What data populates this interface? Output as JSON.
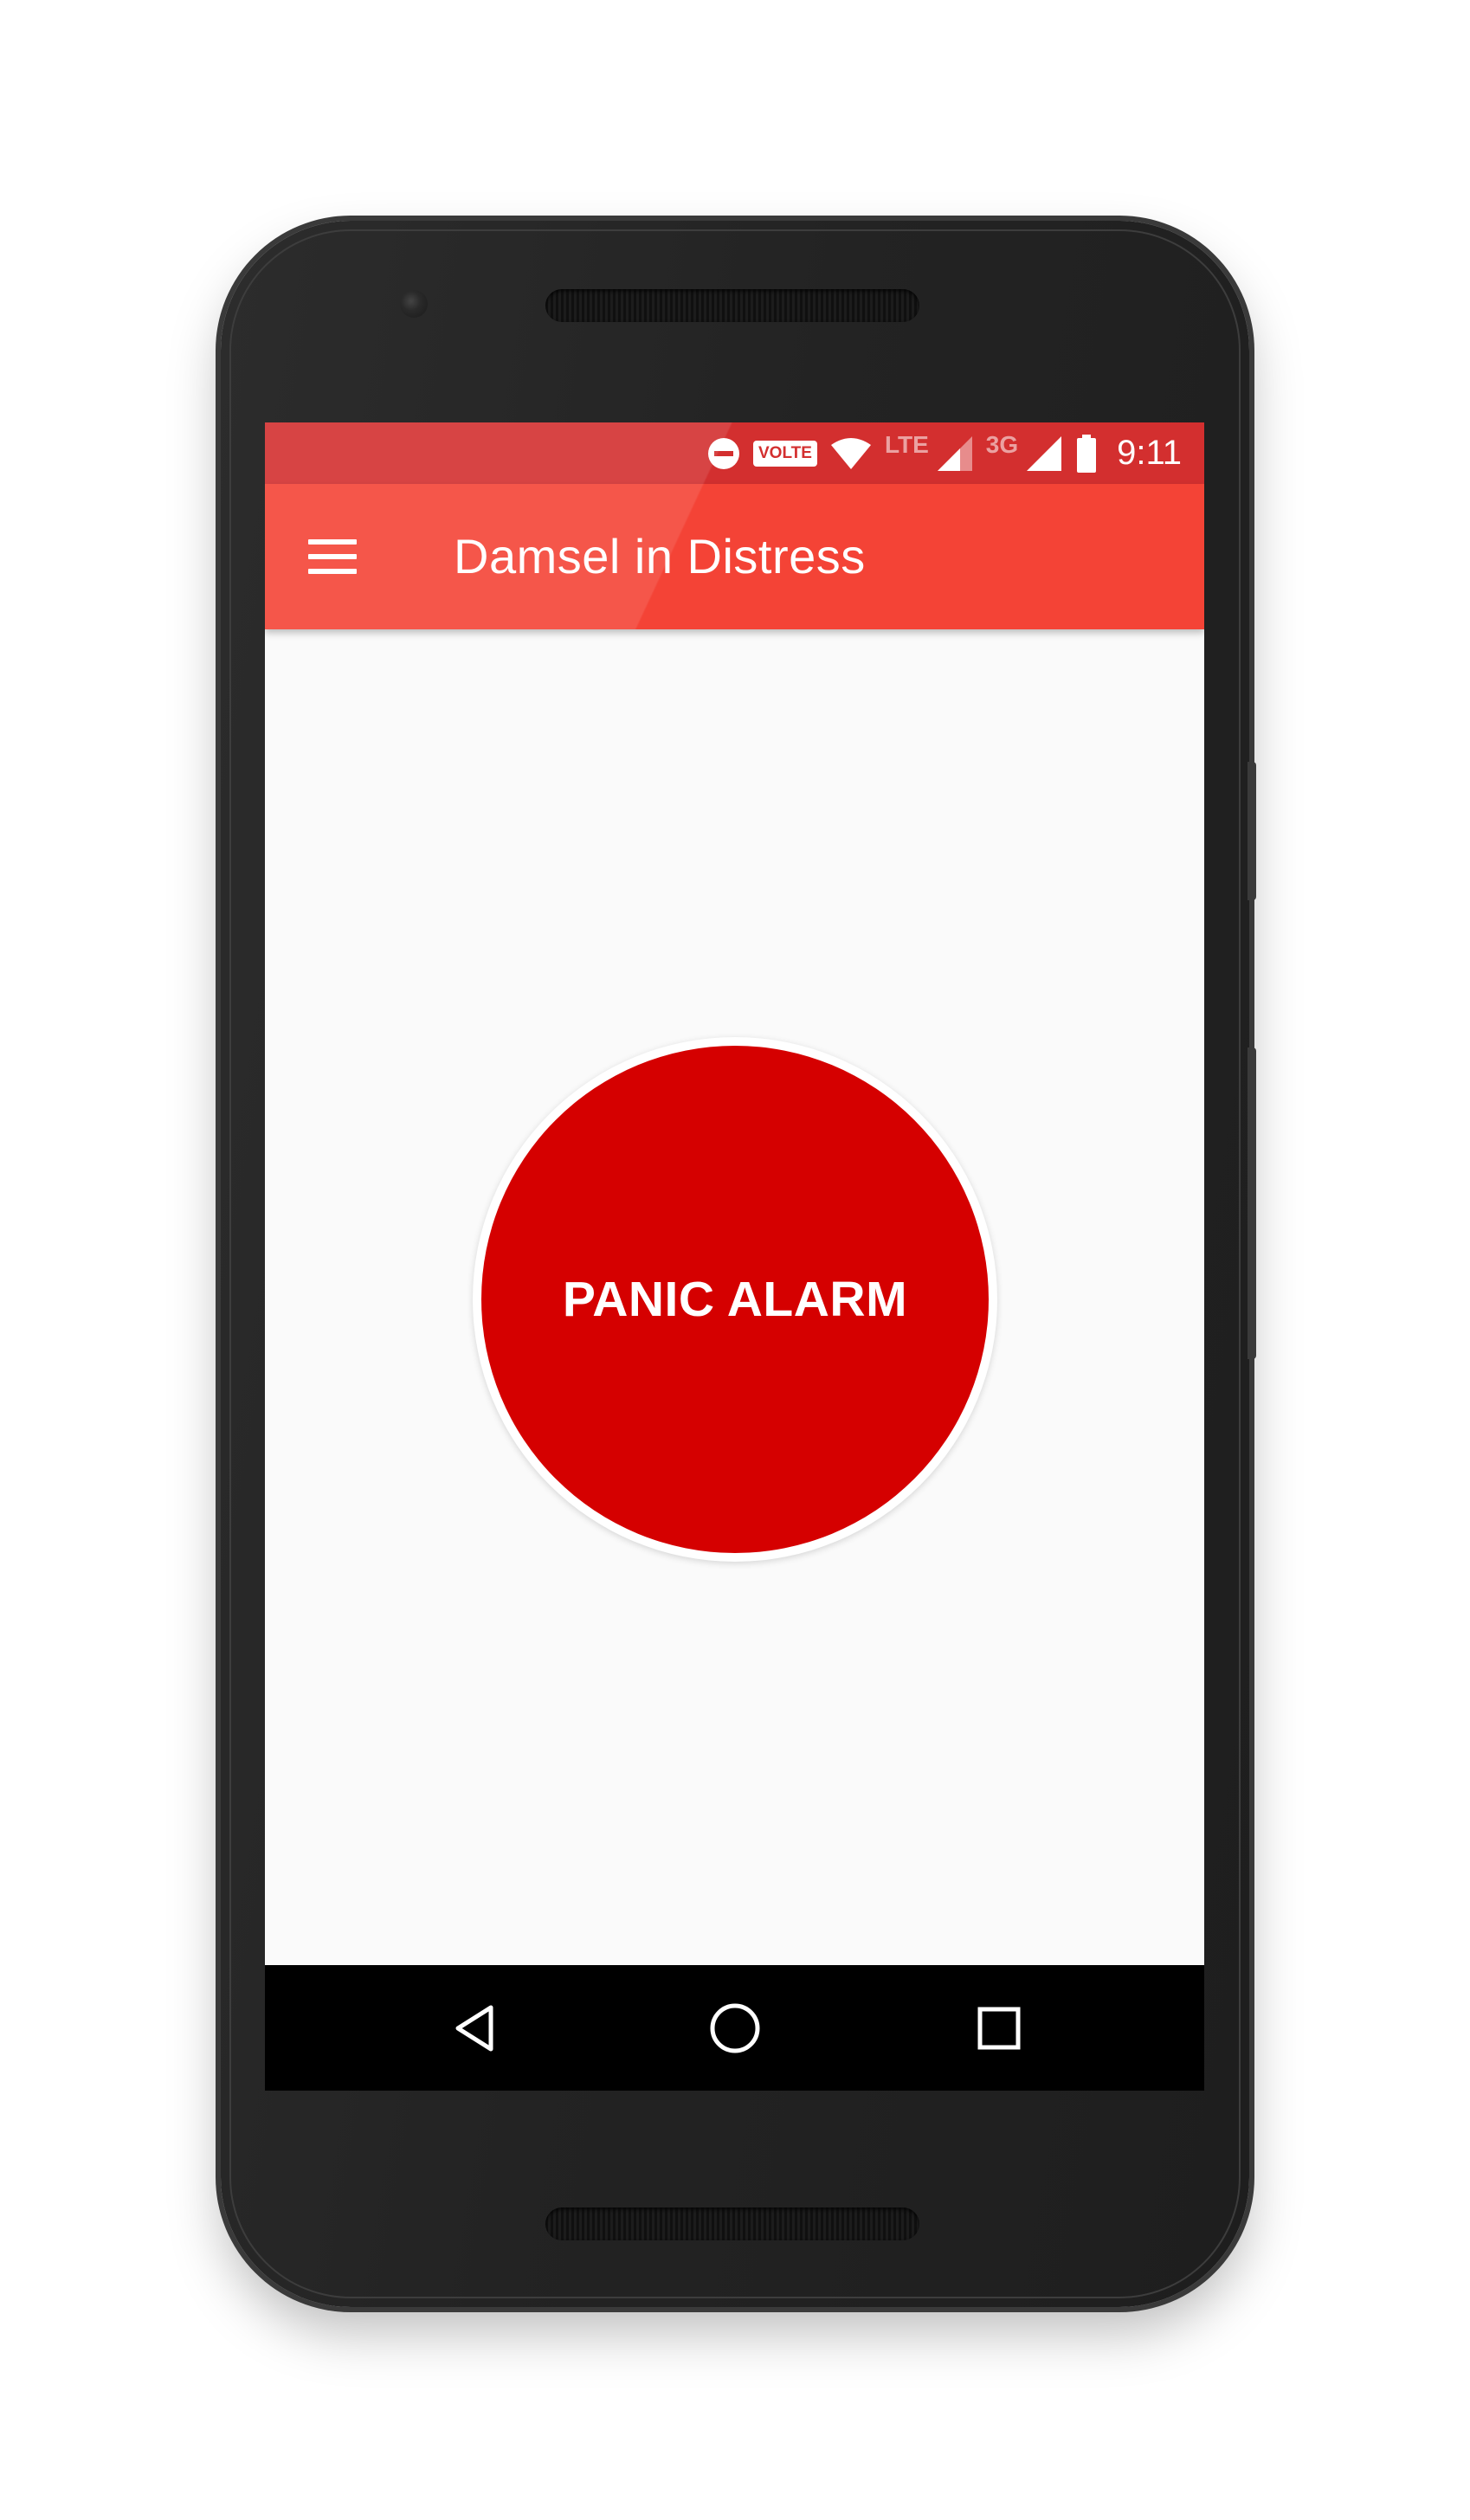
{
  "status_bar": {
    "volte_label": "VOLTE",
    "lte_label": "LTE",
    "network_label": "3G",
    "time": "9:11",
    "icons": [
      "do-not-disturb-icon",
      "volte-icon",
      "wifi-icon",
      "lte-signal-icon",
      "3g-signal-icon",
      "battery-icon"
    ]
  },
  "app_bar": {
    "title": "Damsel in Distress",
    "menu_icon": "hamburger-menu-icon"
  },
  "main": {
    "panic_button_label": "PANIC ALARM"
  },
  "nav_bar": {
    "icons": [
      "back-icon",
      "home-icon",
      "recents-icon"
    ]
  },
  "colors": {
    "status_bar": "#d32f2f",
    "app_bar": "#f44336",
    "panic_button": "#d50000",
    "background": "#fafafa"
  }
}
